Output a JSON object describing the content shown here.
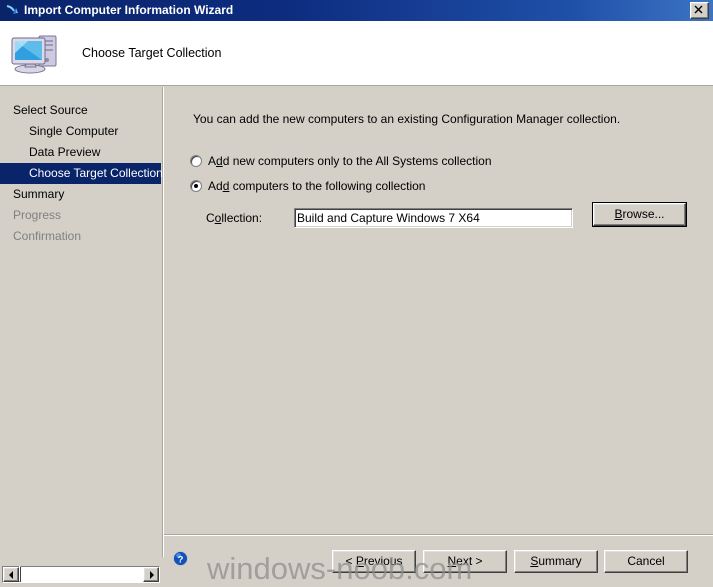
{
  "window": {
    "title": "Import Computer Information Wizard",
    "title_icon": "import-arrow-icon",
    "close_label": "×"
  },
  "header": {
    "title": "Choose Target Collection",
    "icon": "computer-icon"
  },
  "sidebar": {
    "items": [
      {
        "label": "Select Source",
        "level": 0,
        "state": "normal"
      },
      {
        "label": "Single Computer",
        "level": 1,
        "state": "normal"
      },
      {
        "label": "Data Preview",
        "level": 1,
        "state": "normal"
      },
      {
        "label": "Choose Target Collection",
        "level": 1,
        "state": "active"
      },
      {
        "label": "Summary",
        "level": 0,
        "state": "normal"
      },
      {
        "label": "Progress",
        "level": 0,
        "state": "disabled"
      },
      {
        "label": "Confirmation",
        "level": 0,
        "state": "disabled"
      }
    ]
  },
  "main": {
    "intro": "You can add the new computers to an existing Configuration Manager collection.",
    "options": [
      {
        "label_pre": "A",
        "label_key": "d",
        "label_post": "d new computers only to the All Systems collection",
        "selected": false
      },
      {
        "label_pre": "Ad",
        "label_key": "d",
        "label_post": " computers to the following collection",
        "selected": true
      }
    ],
    "collection_label_pre": "C",
    "collection_label_key": "o",
    "collection_label_post": "llection:",
    "collection_value": "Build and Capture Windows 7 X64",
    "collection_placeholder": "",
    "browse_pre": "",
    "browse_key": "B",
    "browse_post": "rowse..."
  },
  "footer": {
    "help_icon": "help-icon",
    "buttons": [
      {
        "pre": "< ",
        "key": "P",
        "post": "revious"
      },
      {
        "pre": "",
        "key": "N",
        "post": "ext >"
      },
      {
        "pre": "",
        "key": "S",
        "post": "ummary"
      },
      {
        "pre": "",
        "key": "",
        "post": "Cancel"
      }
    ]
  },
  "watermark": {
    "text": "windows-noob.com"
  },
  "colors": {
    "titlebar_start": "#0a246a",
    "titlebar_end": "#3c74c4",
    "dialog_face": "#d4d0c8",
    "highlight": "#0a246a",
    "highlight_text": "#ffffff",
    "disabled_text": "#808080",
    "header_bg": "#ffffff"
  }
}
